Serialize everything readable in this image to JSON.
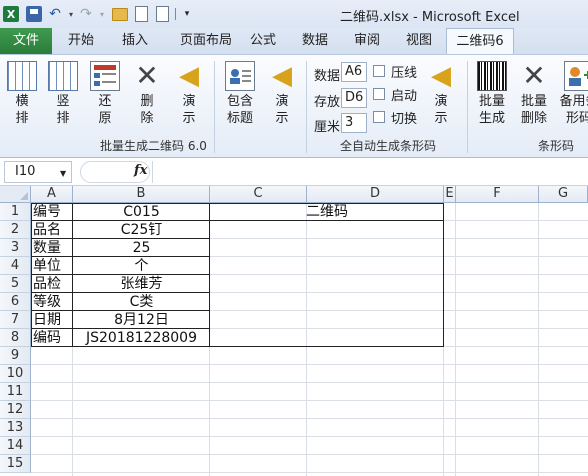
{
  "title_bar": {
    "title": "二维码.xlsx - Microsoft Excel",
    "excel_logo": "X"
  },
  "tabs": [
    {
      "label": "文件",
      "kind": "file"
    },
    {
      "label": "开始"
    },
    {
      "label": "插入"
    },
    {
      "label": "页面布局"
    },
    {
      "label": "公式"
    },
    {
      "label": "数据"
    },
    {
      "label": "审阅"
    },
    {
      "label": "视图"
    },
    {
      "label": "二维码6",
      "active": true
    }
  ],
  "ribbon": {
    "group1": {
      "label": "批量生成二维码 6.0",
      "buttons": [
        {
          "line1": "横",
          "line2": "排",
          "icon": "horizontal-grid-icon"
        },
        {
          "line1": "竖",
          "line2": "排",
          "icon": "vertical-grid-icon"
        },
        {
          "line1": "还",
          "line2": "原",
          "icon": "restore-form-icon"
        },
        {
          "line1": "删",
          "line2": "除",
          "icon": "delete-x-icon"
        },
        {
          "line1": "演",
          "line2": "示",
          "icon": "speaker-icon"
        },
        {
          "line1": "包含",
          "line2": "标题",
          "icon": "card-icon"
        },
        {
          "line1": "演",
          "line2": "示",
          "icon": "speaker-icon"
        }
      ]
    },
    "group2": {
      "label": "全自动生成条形码",
      "fields": [
        {
          "label": "数据",
          "value": "A6"
        },
        {
          "label": "存放",
          "value": "D6"
        },
        {
          "label": "厘米",
          "value": "3"
        }
      ],
      "checkboxes": [
        {
          "label": "压线",
          "checked": false
        },
        {
          "label": "启动",
          "checked": false
        },
        {
          "label": "切换",
          "checked": false
        }
      ],
      "button": {
        "line1": "演",
        "line2": "示",
        "icon": "speaker-icon"
      }
    },
    "group3": {
      "label": "条形码",
      "buttons": [
        {
          "line1": "批量",
          "line2": "生成",
          "icon": "barcode-icon"
        },
        {
          "line1": "批量",
          "line2": "删除",
          "icon": "delete-x-icon"
        },
        {
          "line1": "备用条",
          "line2": "形码",
          "icon": "add-person-icon"
        }
      ]
    }
  },
  "formula_bar": {
    "name_box": "I10",
    "fx": "fx",
    "formula": ""
  },
  "sheet": {
    "columns": [
      "A",
      "B",
      "C",
      "D",
      "E",
      "F",
      "G"
    ],
    "rows": [
      "1",
      "2",
      "3",
      "4",
      "5",
      "6",
      "7",
      "8",
      "9",
      "10",
      "11",
      "12",
      "13",
      "14",
      "15"
    ],
    "cells": [
      {
        "ref": "A1",
        "text": "编号"
      },
      {
        "ref": "B1",
        "text": "C015"
      },
      {
        "ref": "C1",
        "text": "二维码"
      },
      {
        "ref": "A2",
        "text": "品名"
      },
      {
        "ref": "B2",
        "text": "C25钉"
      },
      {
        "ref": "A3",
        "text": "数量"
      },
      {
        "ref": "B3",
        "text": "25"
      },
      {
        "ref": "A4",
        "text": "单位"
      },
      {
        "ref": "B4",
        "text": "个"
      },
      {
        "ref": "A5",
        "text": "品检"
      },
      {
        "ref": "B5",
        "text": "张维芳"
      },
      {
        "ref": "A6",
        "text": "等级"
      },
      {
        "ref": "B6",
        "text": "C类"
      },
      {
        "ref": "A7",
        "text": "日期"
      },
      {
        "ref": "B7",
        "text": "8月12日"
      },
      {
        "ref": "A8",
        "text": "编码"
      },
      {
        "ref": "B8",
        "text": "JS20181228009"
      }
    ]
  }
}
